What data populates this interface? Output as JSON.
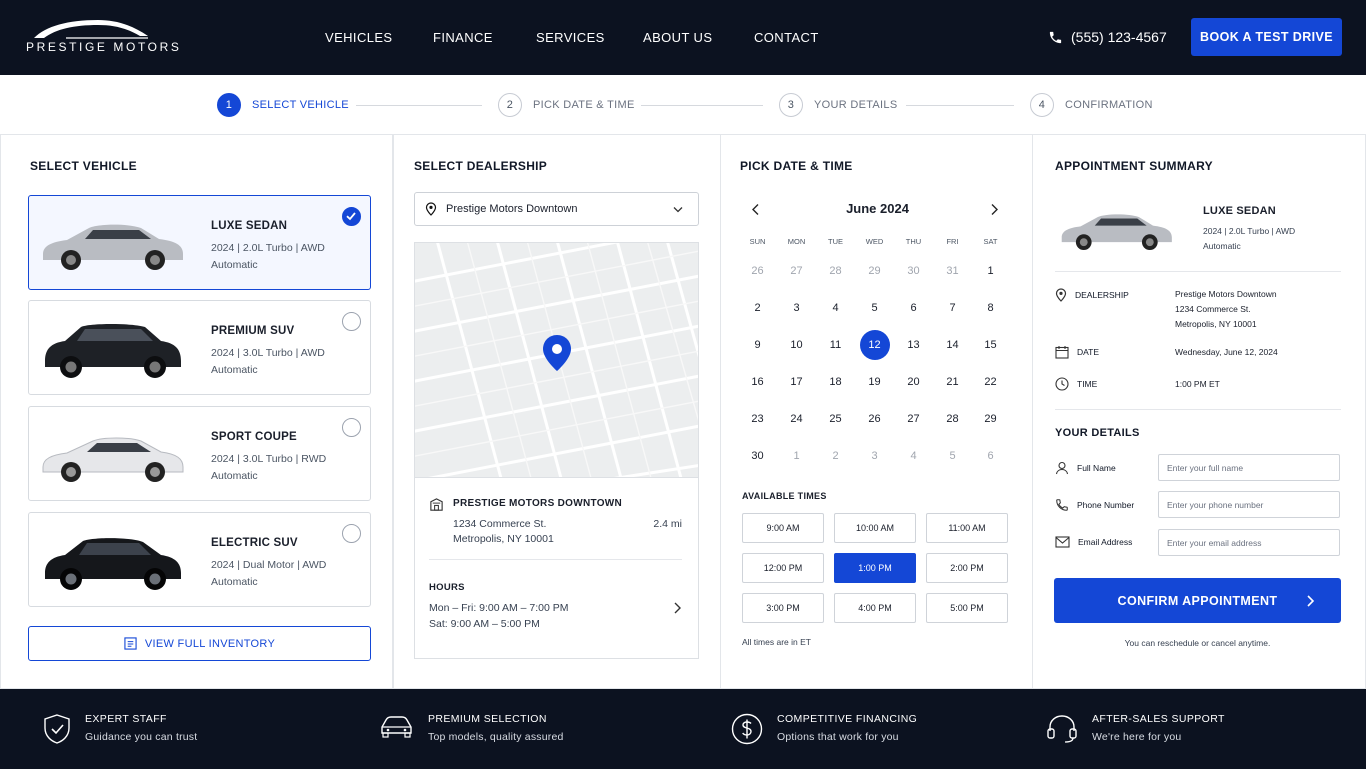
{
  "brand": {
    "name": "PRESTIGE MOTORS"
  },
  "nav": {
    "items": [
      "VEHICLES",
      "FINANCE",
      "SERVICES",
      "ABOUT US",
      "CONTACT"
    ],
    "phone": "(555) 123-4567",
    "cta": "BOOK A TEST DRIVE"
  },
  "steps": [
    {
      "num": "1",
      "label": "SELECT VEHICLE",
      "active": true
    },
    {
      "num": "2",
      "label": "PICK DATE & TIME",
      "active": false
    },
    {
      "num": "3",
      "label": "YOUR DETAILS",
      "active": false
    },
    {
      "num": "4",
      "label": "CONFIRMATION",
      "active": false
    }
  ],
  "vehicles": {
    "title": "SELECT VEHICLE",
    "items": [
      {
        "name": "LUXE SEDAN",
        "spec": "2024 | 2.0L Turbo | AWD Automatic",
        "selected": true,
        "color": "#b9bcc2"
      },
      {
        "name": "PREMIUM SUV",
        "spec": "2024 | 3.0L Turbo | AWD Automatic",
        "selected": false,
        "color": "#1e2126"
      },
      {
        "name": "SPORT COUPE",
        "spec": "2024 | 3.0L Turbo | RWD Automatic",
        "selected": false,
        "color": "#e9eaec"
      },
      {
        "name": "ELECTRIC SUV",
        "spec": "2024 | Dual Motor | AWD Automatic",
        "selected": false,
        "color": "#15171b"
      }
    ],
    "inventory_link": "VIEW FULL INVENTORY"
  },
  "dealership": {
    "title": "SELECT DEALERSHIP",
    "selected": "Prestige Motors Downtown",
    "name": "PRESTIGE MOTORS DOWNTOWN",
    "address1": "1234 Commerce St.",
    "address2": "Metropolis, NY 10001",
    "distance": "2.4 mi",
    "hours_label": "HOURS",
    "hours1": "Mon – Fri:  9:00 AM – 7:00 PM",
    "hours2": "Sat:  9:00 AM – 5:00 PM"
  },
  "calendar": {
    "title": "PICK DATE & TIME",
    "month": "June 2024",
    "weekdays": [
      "SUN",
      "MON",
      "TUE",
      "WED",
      "THU",
      "FRI",
      "SAT"
    ],
    "weeks": [
      [
        "26",
        "27",
        "28",
        "29",
        "30",
        "31",
        "1"
      ],
      [
        "2",
        "3",
        "4",
        "5",
        "6",
        "7",
        "8"
      ],
      [
        "9",
        "10",
        "11",
        "12",
        "13",
        "14",
        "15"
      ],
      [
        "16",
        "17",
        "18",
        "19",
        "20",
        "21",
        "22"
      ],
      [
        "23",
        "24",
        "25",
        "26",
        "27",
        "28",
        "29"
      ],
      [
        "30",
        "1",
        "2",
        "3",
        "4",
        "5",
        "6"
      ]
    ],
    "selected_day": "12",
    "times_label": "AVAILABLE TIMES",
    "times": [
      "9:00 AM",
      "10:00 AM",
      "11:00 AM",
      "12:00 PM",
      "1:00 PM",
      "2:00 PM",
      "3:00 PM",
      "4:00 PM",
      "5:00 PM"
    ],
    "selected_time": "1:00 PM",
    "tz_note": "All times are in ET"
  },
  "summary": {
    "title": "APPOINTMENT SUMMARY",
    "vehicle": "LUXE SEDAN",
    "vehicle_spec": "2024 | 2.0L Turbo | AWD Automatic",
    "dealership_label": "DEALERSHIP",
    "dealership_value": [
      "Prestige Motors Downtown",
      "1234 Commerce St.",
      "Metropolis, NY 10001"
    ],
    "date_label": "DATE",
    "date_value": "Wednesday, June 12, 2024",
    "time_label": "TIME",
    "time_value": "1:00 PM ET",
    "details_title": "YOUR DETAILS",
    "fields": [
      {
        "label": "Full Name",
        "placeholder": "Enter your full name"
      },
      {
        "label": "Phone Number",
        "placeholder": "Enter your phone number"
      },
      {
        "label": "Email Address",
        "placeholder": "Enter your email address"
      }
    ],
    "confirm": "CONFIRM APPOINTMENT",
    "note": "You can reschedule or cancel anytime."
  },
  "features": [
    {
      "title": "EXPERT STAFF",
      "text": "Guidance you can trust",
      "icon": "shield-check-icon"
    },
    {
      "title": "PREMIUM SELECTION",
      "text": "Top models, quality assured",
      "icon": "car-icon"
    },
    {
      "title": "COMPETITIVE FINANCING",
      "text": "Options that work for you",
      "icon": "dollar-icon"
    },
    {
      "title": "AFTER-SALES SUPPORT",
      "text": "We're here for you",
      "icon": "headset-icon"
    }
  ],
  "colors": {
    "accent": "#1447d6",
    "navy": "#0c1220"
  }
}
